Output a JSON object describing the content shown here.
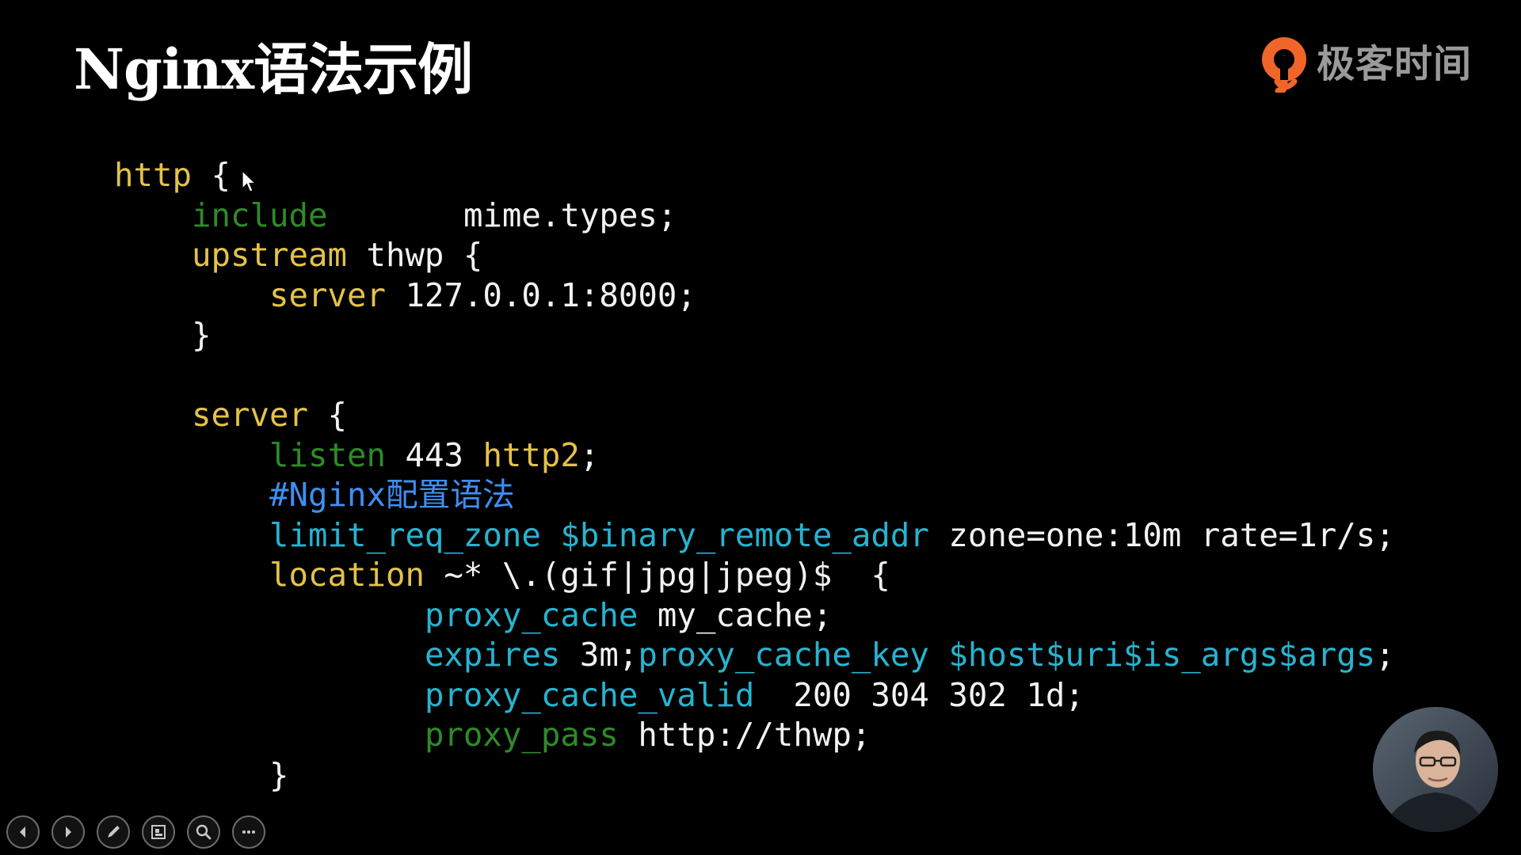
{
  "slide": {
    "title": "Nginx语法示例"
  },
  "brand": {
    "name": "极客时间",
    "logo_icon": "geektime-logo-icon",
    "logo_color": "#f0662a"
  },
  "code": {
    "colors": {
      "keyword_yellow": "#e3c24a",
      "keyword_green": "#2f8a2a",
      "keyword_cyan": "#27b3cf",
      "comment_blue": "#3f8ef2",
      "plain": "#f2f2f2"
    },
    "lines": [
      [
        {
          "t": "http",
          "c": "yellow"
        },
        {
          "t": " {",
          "c": "white"
        }
      ],
      [
        {
          "t": "    ",
          "c": "white"
        },
        {
          "t": "include",
          "c": "green"
        },
        {
          "t": "       mime.types;",
          "c": "white"
        }
      ],
      [
        {
          "t": "    ",
          "c": "white"
        },
        {
          "t": "upstream",
          "c": "yellow"
        },
        {
          "t": " thwp {",
          "c": "white"
        }
      ],
      [
        {
          "t": "        ",
          "c": "white"
        },
        {
          "t": "server",
          "c": "yellow"
        },
        {
          "t": " 127.0.0.1:8000;",
          "c": "white"
        }
      ],
      [
        {
          "t": "    }",
          "c": "white"
        }
      ],
      [],
      [
        {
          "t": "    ",
          "c": "white"
        },
        {
          "t": "server",
          "c": "yellow"
        },
        {
          "t": " {",
          "c": "white"
        }
      ],
      [
        {
          "t": "        ",
          "c": "white"
        },
        {
          "t": "listen",
          "c": "green"
        },
        {
          "t": " 443 ",
          "c": "white"
        },
        {
          "t": "http2",
          "c": "yellow"
        },
        {
          "t": ";",
          "c": "white"
        }
      ],
      [
        {
          "t": "        ",
          "c": "white"
        },
        {
          "t": "#Nginx配置语法",
          "c": "blue"
        }
      ],
      [
        {
          "t": "        ",
          "c": "white"
        },
        {
          "t": "limit_req_zone",
          "c": "cyan"
        },
        {
          "t": " ",
          "c": "white"
        },
        {
          "t": "$binary_remote_addr",
          "c": "cyan"
        },
        {
          "t": " zone=one:10m rate=1r/s;",
          "c": "white"
        }
      ],
      [
        {
          "t": "        ",
          "c": "white"
        },
        {
          "t": "location",
          "c": "yellow"
        },
        {
          "t": " ~* \\.(gif|jpg|jpeg)$  {",
          "c": "white"
        }
      ],
      [
        {
          "t": "                ",
          "c": "white"
        },
        {
          "t": "proxy_cache",
          "c": "cyan"
        },
        {
          "t": " my_cache;",
          "c": "white"
        }
      ],
      [
        {
          "t": "                ",
          "c": "white"
        },
        {
          "t": "expires",
          "c": "cyan"
        },
        {
          "t": " 3m;",
          "c": "white"
        },
        {
          "t": "proxy_cache_key",
          "c": "cyan"
        },
        {
          "t": " ",
          "c": "white"
        },
        {
          "t": "$host$uri$is_args$args",
          "c": "cyan"
        },
        {
          "t": ";",
          "c": "white"
        }
      ],
      [
        {
          "t": "                ",
          "c": "white"
        },
        {
          "t": "proxy_cache_valid",
          "c": "cyan"
        },
        {
          "t": "  200 304 302 1d;",
          "c": "white"
        }
      ],
      [
        {
          "t": "                ",
          "c": "white"
        },
        {
          "t": "proxy_pass",
          "c": "green"
        },
        {
          "t": " http://thwp;",
          "c": "white"
        }
      ],
      [
        {
          "t": "        }",
          "c": "white"
        }
      ]
    ]
  },
  "mouse_cursor": {
    "icon": "mouse-cursor-icon"
  },
  "controls": [
    {
      "name": "previous-slide-button",
      "icon": "arrow-left-icon"
    },
    {
      "name": "next-slide-button",
      "icon": "arrow-right-icon"
    },
    {
      "name": "pen-tool-button",
      "icon": "pen-icon"
    },
    {
      "name": "slide-overview-button",
      "icon": "slides-grid-icon"
    },
    {
      "name": "zoom-button",
      "icon": "magnifier-icon"
    },
    {
      "name": "more-options-button",
      "icon": "ellipsis-icon"
    }
  ],
  "presenter": {
    "icon": "presenter-video-avatar"
  }
}
